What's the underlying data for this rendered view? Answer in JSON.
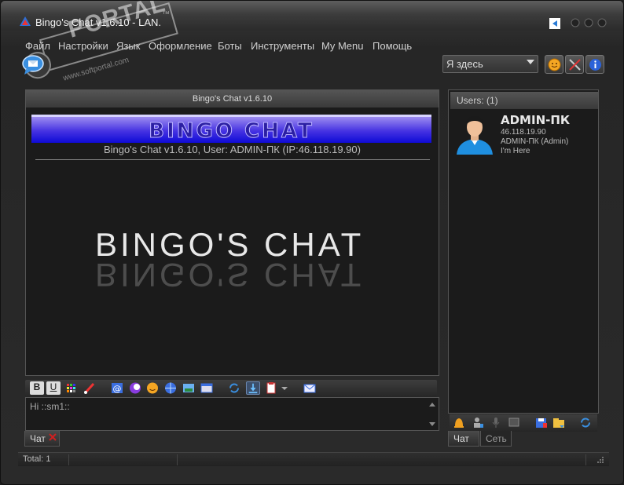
{
  "window": {
    "title": "Bingo's Chat v1.6.10 - LAN.",
    "watermark_text": "PORTAL",
    "watermark_url": "www.softportal.com",
    "watermark_tm": "™"
  },
  "menu": {
    "items": [
      "Файл",
      "Настройки",
      "Язык",
      "Оформление",
      "Боты",
      "Инструменты",
      "My Menu",
      "Помощь"
    ]
  },
  "status": {
    "selected": "Я здесь"
  },
  "chat": {
    "panel_title": "Bingo's Chat v1.6.10",
    "banner_text": "BINGO CHAT",
    "version_line": "Bingo's Chat v1.6.10, User: ADMIN-ПК (IP:46.118.19.90)",
    "logo_text": "Bingo's Chat",
    "input_value": "Hi ::sm1::"
  },
  "tabs": {
    "chat_tab": "Чат",
    "close_icon": "x-icon"
  },
  "users": {
    "header": "Users: (1)",
    "list": [
      {
        "name": "ADMIN-ПК",
        "ip": "46.118.19.90",
        "role": "ADMIN-ПК (Admin)",
        "status": "I'm Here"
      }
    ],
    "tabs": [
      "Чат",
      "Сеть"
    ]
  },
  "statusbar": {
    "total": "Total: 1"
  },
  "colors": {
    "accent_blue": "#3a6ee0",
    "banner_purple": "#4532e2",
    "close_red": "#d02020"
  }
}
